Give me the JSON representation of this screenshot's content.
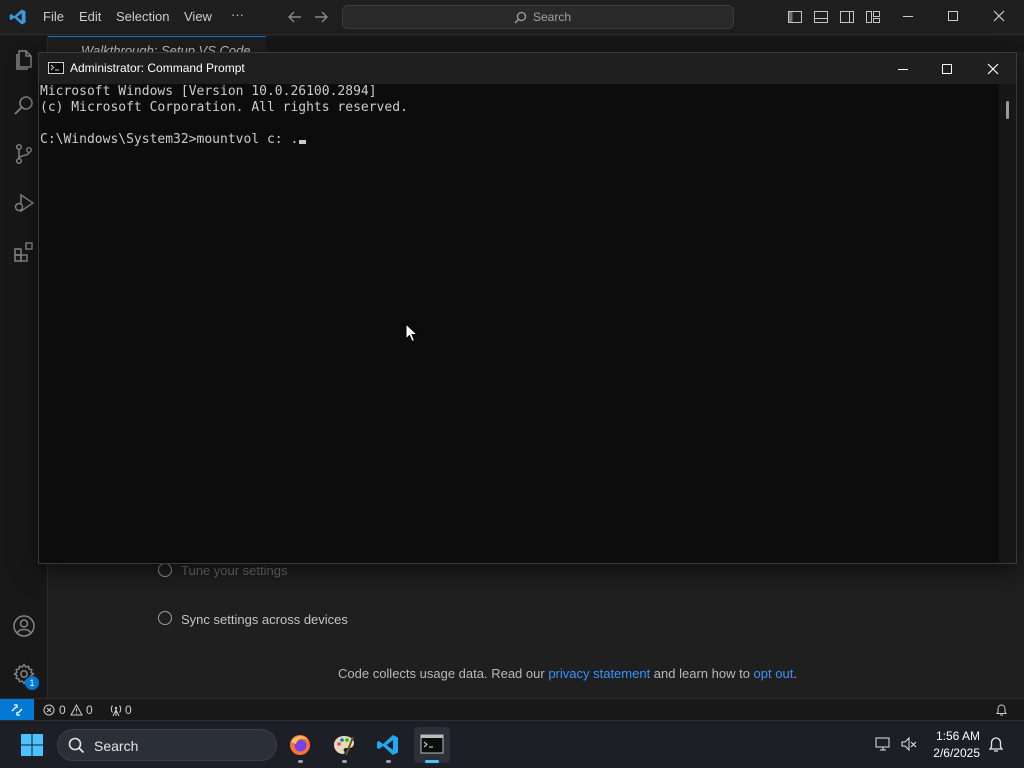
{
  "vscode": {
    "menu": [
      "File",
      "Edit",
      "Selection",
      "View",
      "···"
    ],
    "command_center": {
      "label": "Search"
    },
    "tab": {
      "label": "Walkthrough: Setup VS Code"
    },
    "welcome_steps": [
      "Tune your settings",
      "Sync settings across devices"
    ],
    "footer_note": {
      "prefix": "Code collects usage data. Read our ",
      "privacy_link": "privacy statement",
      "middle": " and learn how to ",
      "opt_out_link": "opt out",
      "suffix": "."
    },
    "statusbar": {
      "errors": "0",
      "warnings": "0",
      "ports": "0"
    },
    "accounts_badge": "1"
  },
  "cmd": {
    "title": "Administrator: Command Prompt",
    "lines": [
      "Microsoft Windows [Version 10.0.26100.2894]",
      "(c) Microsoft Corporation. All rights reserved.",
      "",
      "C:\\Windows\\System32>mountvol c: ."
    ]
  },
  "taskbar": {
    "search_label": "Search",
    "time": "1:56 AM",
    "date": "2/6/2025"
  },
  "colors": {
    "accent": "#0078d4",
    "link": "#3794ff",
    "console_bg": "#0c0c0c"
  }
}
